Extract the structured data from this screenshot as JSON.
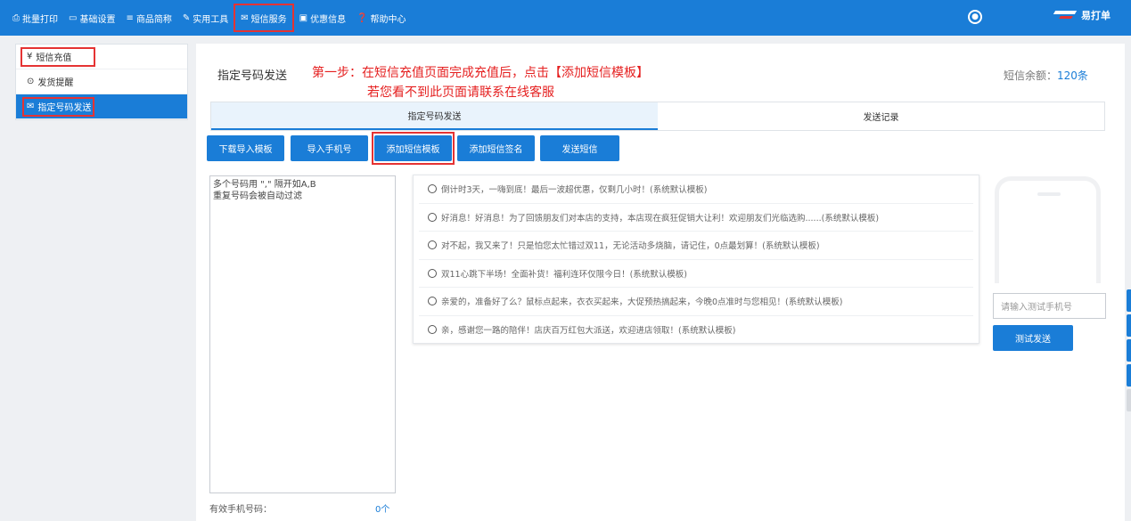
{
  "nav": {
    "items": [
      {
        "icon": "print-icon",
        "glyph": "⎙",
        "label": "批量打印"
      },
      {
        "icon": "monitor-icon",
        "glyph": "▭",
        "label": "基础设置"
      },
      {
        "icon": "list-icon",
        "glyph": "≡",
        "label": "商品简称"
      },
      {
        "icon": "wrench-icon",
        "glyph": "✎",
        "label": "实用工具"
      },
      {
        "icon": "envelope-icon",
        "glyph": "✉",
        "label": "短信服务"
      },
      {
        "icon": "coupon-icon",
        "glyph": "▣",
        "label": "优惠信息"
      },
      {
        "icon": "help-icon",
        "glyph": "❓",
        "label": "帮助中心"
      }
    ],
    "brand": "易打单"
  },
  "sidebar": {
    "items": [
      {
        "icon": "yen-icon",
        "glyph": "¥",
        "label": "短信充值"
      },
      {
        "icon": "clock-icon",
        "glyph": "⊙",
        "label": "发货提醒"
      },
      {
        "icon": "envelope-icon",
        "glyph": "✉",
        "label": "指定号码发送"
      }
    ]
  },
  "main": {
    "title": "指定号码发送",
    "note_line1": "第一步：在短信充值页面完成充值后，点击【添加短信模板】",
    "note_line2": "若您看不到此页面请联系在线客服",
    "balance_label": "短信余额：",
    "balance_value": "120条",
    "tabs": [
      "指定号码发送",
      "发送记录"
    ],
    "buttons": [
      "下载导入模板",
      "导入手机号",
      "添加短信模板",
      "添加短信签名",
      "发送短信"
    ],
    "numbers_placeholder": "多个号码用 \",\" 隔开如A,B\n重复号码会被自动过滤",
    "valid_label": "有效手机号码：",
    "valid_count": "0个",
    "templates": [
      "倒计时3天，一嗨到底！最后一波超优惠，仅剩几小时！(系统默认模板)",
      "好消息！好消息！为了回馈朋友们对本店的支持，本店现在疯狂促销大让利！欢迎朋友们光临选购......(系统默认模板)",
      "对不起，我又来了！只是怕您太忙错过双11，无论活动多烧脑，请记住，0点最划算！(系统默认模板)",
      "双11心跳下半场！全面补货！福利连环仅限今日！(系统默认模板)",
      "亲爱的，准备好了么？鼠标点起来，衣衣买起来，大促预热搞起来，今晚0点准时与您相见！(系统默认模板)",
      "亲，感谢您一路的陪伴！店庆百万红包大派送，欢迎进店领取！(系统默认模板)"
    ],
    "test_placeholder": "请输入测试手机号",
    "test_button": "测试发送"
  },
  "colors": {
    "primary": "#1a7dd7",
    "highlight": "#e53333",
    "note": "#e52020"
  }
}
